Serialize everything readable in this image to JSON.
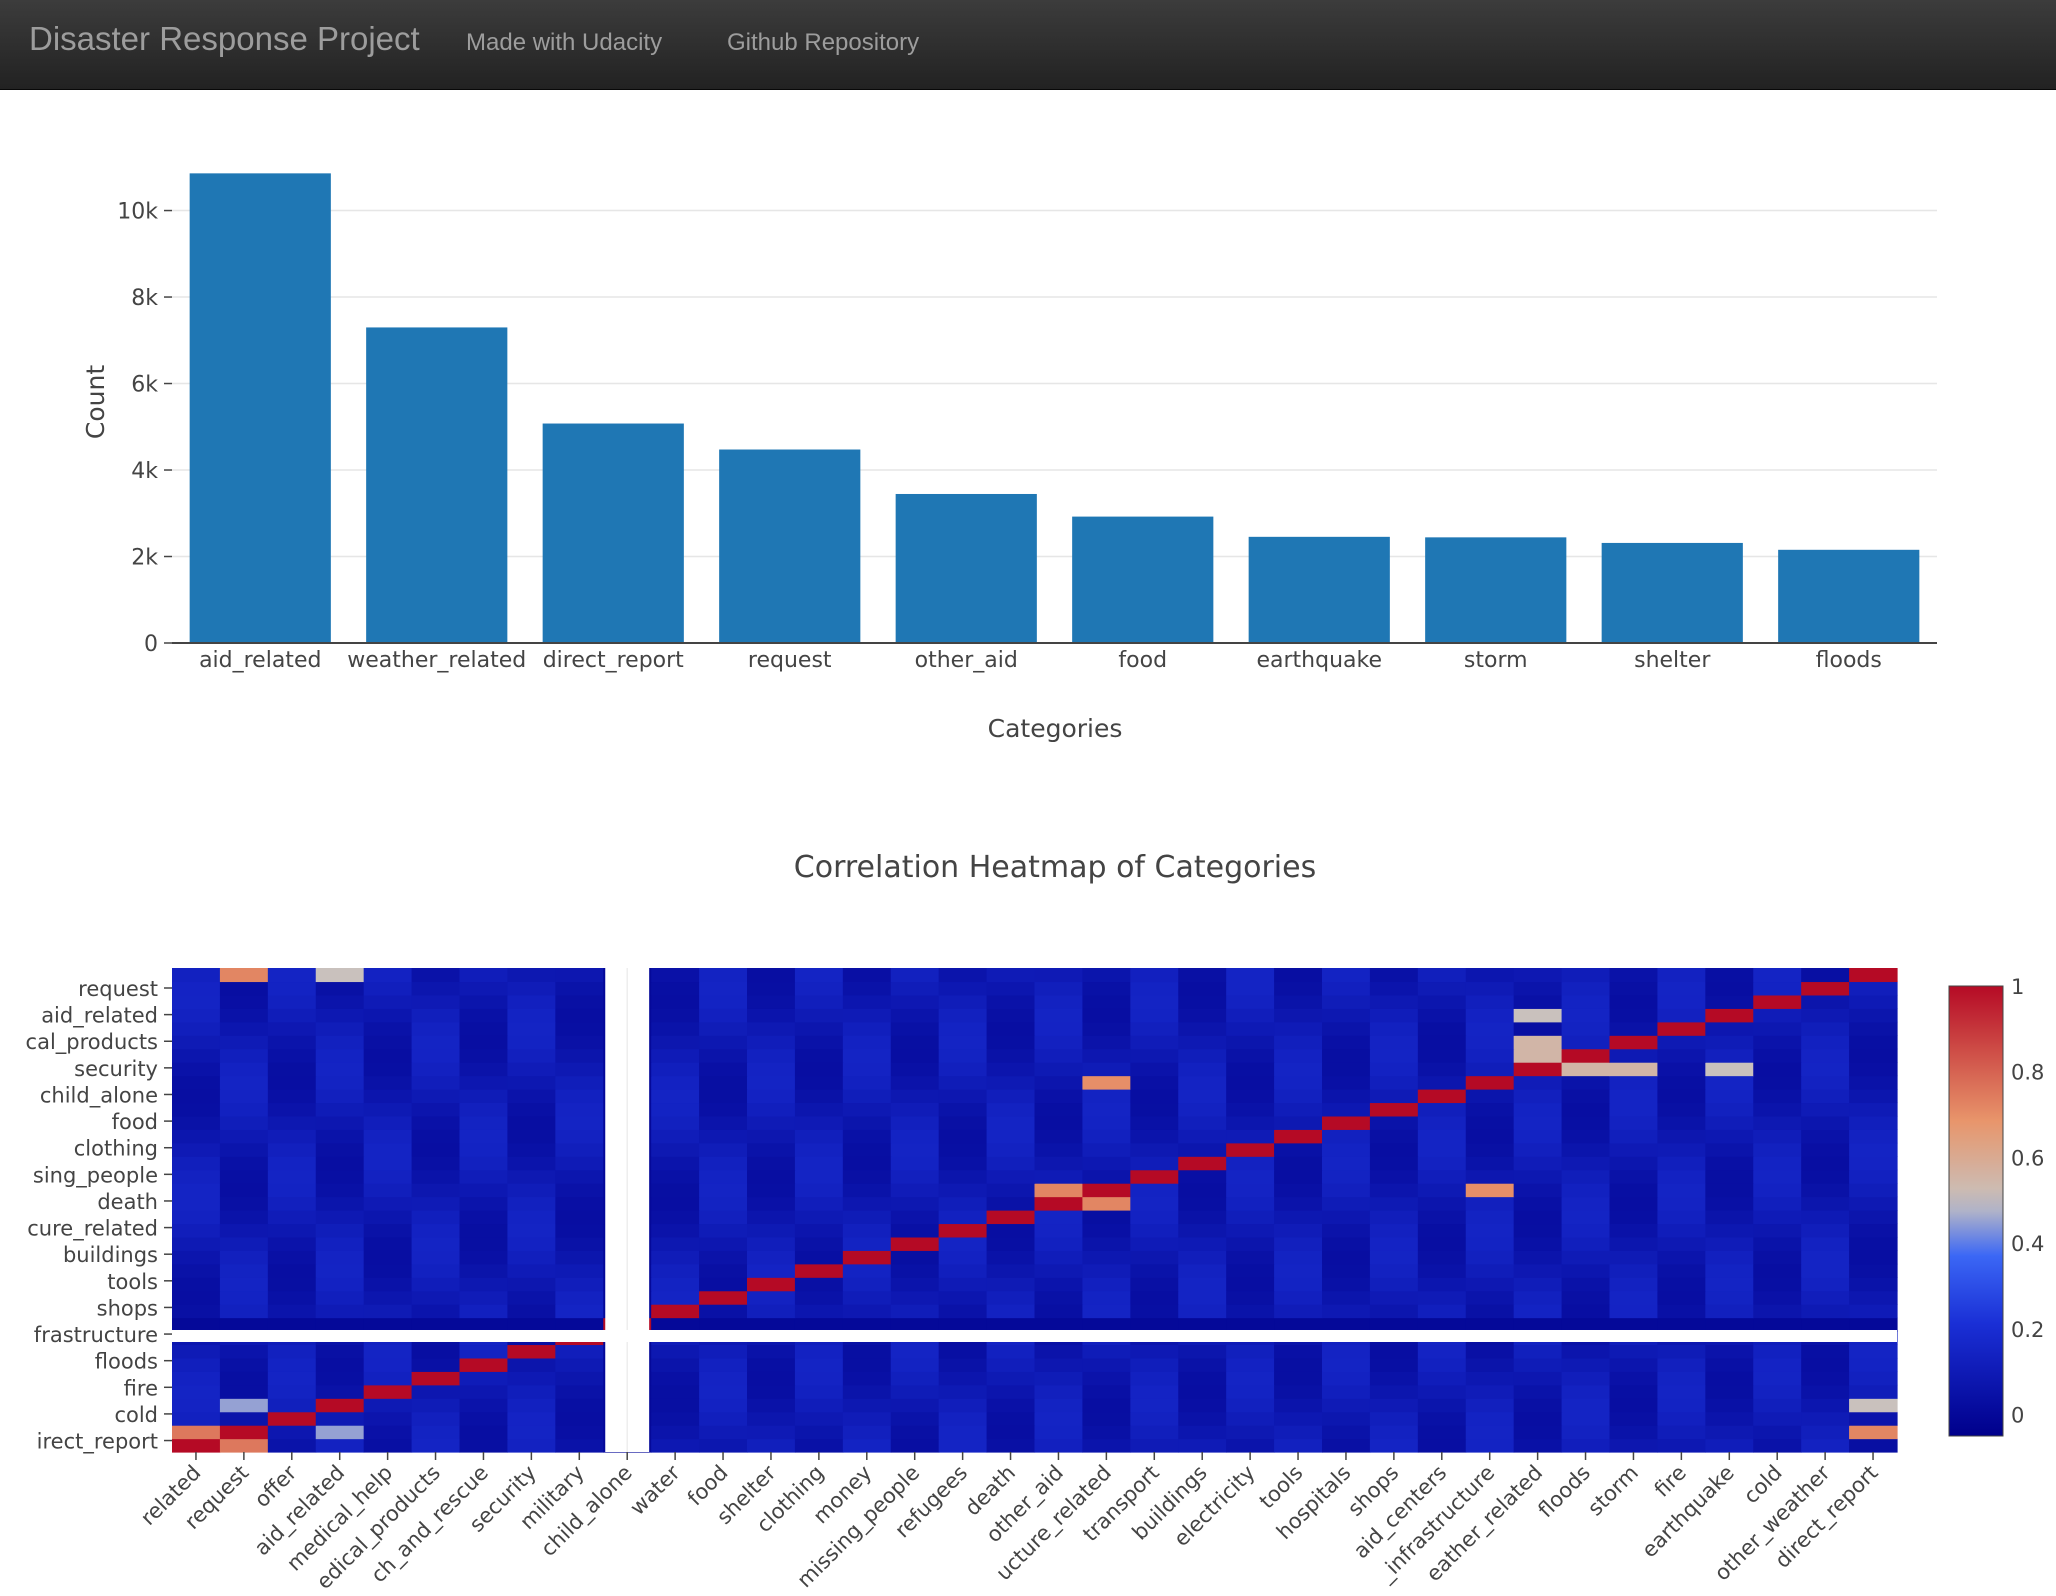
{
  "navbar": {
    "brand": "Disaster Response Project",
    "links": [
      "Made with Udacity",
      "Github Repository"
    ]
  },
  "colors": {
    "bar": "#1f77b4",
    "navbar_bg": "#222222",
    "navbar_text": "#9d9d9d",
    "heatmap_scale": [
      "#00008b",
      "#1a2fd6",
      "#3b67f5",
      "#c8c2bf",
      "#e8956b",
      "#b50a25"
    ]
  },
  "chart_data": [
    {
      "type": "bar",
      "title": "",
      "xlabel": "Categories",
      "ylabel": "Count",
      "categories": [
        "aid_related",
        "weather_related",
        "direct_report",
        "request",
        "other_aid",
        "food",
        "earthquake",
        "storm",
        "shelter",
        "floods"
      ],
      "values": [
        10860,
        7297,
        5075,
        4474,
        3446,
        2923,
        2455,
        2443,
        2314,
        2155
      ],
      "ylim": [
        0,
        11400
      ],
      "yticks": [
        0,
        2000,
        4000,
        6000,
        8000,
        10000
      ],
      "ytick_labels": [
        "0",
        "2k",
        "4k",
        "6k",
        "8k",
        "10k"
      ],
      "grid": true
    },
    {
      "type": "heatmap",
      "title": "Correlation Heatmap of Categories",
      "x_labels": [
        "related",
        "request",
        "offer",
        "aid_related",
        "medical_help",
        "medical_products",
        "search_and_rescue",
        "security",
        "military",
        "child_alone",
        "water",
        "food",
        "shelter",
        "clothing",
        "money",
        "missing_people",
        "refugees",
        "death",
        "other_aid",
        "infrastructure_related",
        "transport",
        "buildings",
        "electricity",
        "tools",
        "hospitals",
        "shops",
        "aid_centers",
        "other_infrastructure",
        "weather_related",
        "floods",
        "storm",
        "fire",
        "earthquake",
        "cold",
        "other_weather",
        "direct_report"
      ],
      "y_labels_visible": [
        "request",
        "aid_related",
        "medical_products",
        "security",
        "child_alone",
        "food",
        "clothing",
        "missing_people",
        "death",
        "infrastructure_related",
        "buildings",
        "tools",
        "shops",
        "other_infrastructure",
        "floods",
        "fire",
        "cold",
        "direct_report"
      ],
      "ylabel_display": [
        "request",
        "aid_related",
        "cal_products",
        "security",
        "child_alone",
        "food",
        "clothing",
        "sing_people",
        "death",
        "cure_related",
        "buildings",
        "tools",
        "shops",
        "frastructure",
        "floods",
        "fire",
        "cold",
        "irect_report"
      ],
      "xlabel_display": [
        "related",
        "request",
        "offer",
        "aid_related",
        "medical_help",
        "edical_products",
        "ch_and_rescue",
        "security",
        "military",
        "child_alone",
        "water",
        "food",
        "shelter",
        "clothing",
        "money",
        "missing_people",
        "refugees",
        "death",
        "other_aid",
        "ucture_related",
        "transport",
        "buildings",
        "electricity",
        "tools",
        "hospitals",
        "shops",
        "aid_centers",
        "_infrastructure",
        "eather_related",
        "floods",
        "storm",
        "fire",
        "earthquake",
        "cold",
        "other_weather",
        "direct_report"
      ],
      "zlim": [
        -0.05,
        1
      ],
      "colorbar_ticks": [
        0,
        0.2,
        0.4,
        0.6,
        0.8,
        1
      ],
      "colorbar_labels": [
        "0",
        "0.2",
        "0.4",
        "0.6",
        "0.8",
        "1"
      ],
      "notable_correlations": [
        {
          "x": "request",
          "y": "related",
          "value": 0.75
        },
        {
          "x": "aid_related",
          "y": "request",
          "value": 0.45
        },
        {
          "x": "aid_related",
          "y": "direct_report",
          "value": 0.5
        },
        {
          "x": "infrastructure_related",
          "y": "other_aid",
          "value": 0.72
        },
        {
          "x": "weather_related",
          "y": "floods",
          "value": 0.55
        },
        {
          "x": "weather_related",
          "y": "earthquake",
          "value": 0.5
        },
        {
          "x": "weather_related",
          "y": "storm",
          "value": 0.55
        },
        {
          "x": "other_infrastructure",
          "y": "infrastructure_related",
          "value": 0.7
        },
        {
          "x": "direct_report",
          "y": "request",
          "value": 0.72
        }
      ]
    }
  ]
}
